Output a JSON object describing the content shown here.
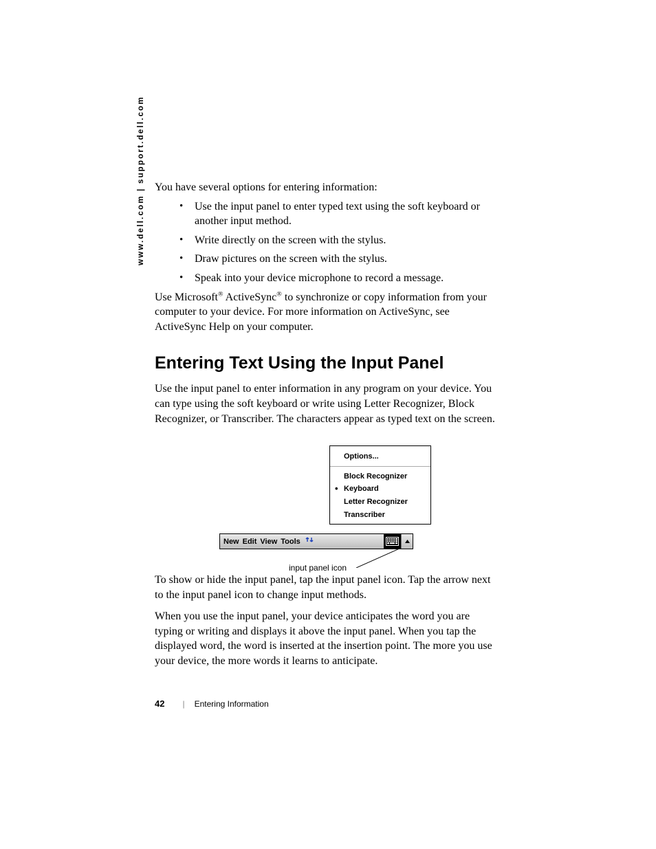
{
  "sidebar_url": "www.dell.com | support.dell.com",
  "intro_line": "You have several options for entering information:",
  "bullets": [
    "Use the input panel to enter typed text using the soft keyboard or another input method.",
    "Write directly on the screen with the stylus.",
    "Draw pictures on the screen with the stylus.",
    "Speak into your device microphone to record a message."
  ],
  "sync_para_pre": "Use Microsoft",
  "sync_para_mid": " ActiveSync",
  "sync_para_post": " to synchronize or copy information from your computer to your device. For more information on ActiveSync, see ActiveSync Help on your computer.",
  "reg_symbol": "®",
  "heading": "Entering Text Using the Input Panel",
  "heading_para": "Use the input panel to enter information in any program on your device. You can type using the soft keyboard or write using Letter Recognizer, Block Recognizer, or Transcriber. The characters appear as typed text on the screen.",
  "menu": {
    "options": "Options...",
    "items": [
      "Block Recognizer",
      "Keyboard",
      "Letter Recognizer",
      "Transcriber"
    ],
    "selected_index": 1
  },
  "taskbar": {
    "new": "New",
    "edit": "Edit",
    "view": "View",
    "tools": "Tools"
  },
  "figure_caption": "input panel icon",
  "after_fig_p1": "To show or hide the input panel, tap the input panel icon. Tap the arrow next to the input panel icon to change input methods.",
  "after_fig_p2": "When you use the input panel, your device anticipates the word you are typing or writing and displays it above the input panel. When you tap the displayed word, the word is inserted at the insertion point. The more you use your device, the more words it learns to anticipate.",
  "footer": {
    "page": "42",
    "chapter": "Entering Information"
  }
}
